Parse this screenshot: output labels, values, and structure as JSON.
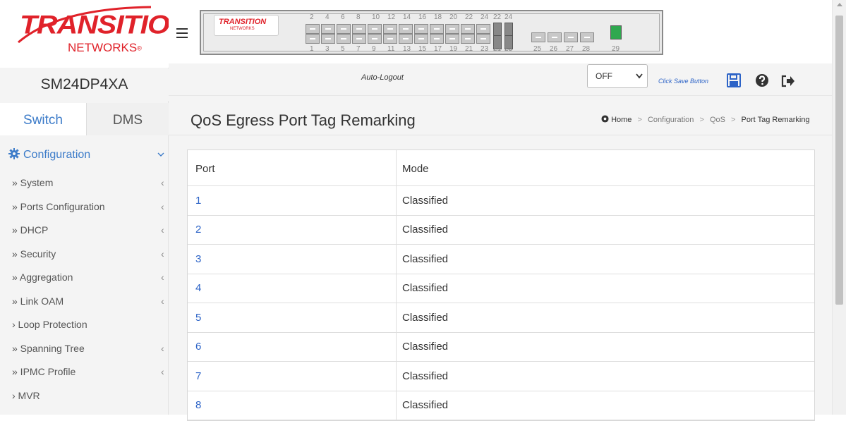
{
  "brand": {
    "name_top": "TRANSITION",
    "name_bottom": "NETWORKS",
    "reg": "®"
  },
  "model": "SM24DP4XA",
  "tabs": [
    {
      "label": "Switch"
    },
    {
      "label": "DMS"
    }
  ],
  "nav": {
    "config_label": "Configuration",
    "items": [
      {
        "label": "» System",
        "arrow": "‹"
      },
      {
        "label": "» Ports Configuration",
        "arrow": "‹"
      },
      {
        "label": "» DHCP",
        "arrow": "‹"
      },
      {
        "label": "» Security",
        "arrow": "‹"
      },
      {
        "label": "» Aggregation",
        "arrow": "‹"
      },
      {
        "label": "» Link OAM",
        "arrow": "‹"
      },
      {
        "label": "› Loop Protection",
        "arrow": ""
      },
      {
        "label": "» Spanning Tree",
        "arrow": "‹"
      },
      {
        "label": "» IPMC Profile",
        "arrow": "‹"
      },
      {
        "label": "› MVR",
        "arrow": ""
      }
    ]
  },
  "panel": {
    "logo_top": "TRANSITION",
    "logo_bottom": "NETWORKS",
    "top_ports": [
      "2",
      "4",
      "6",
      "8",
      "10",
      "12",
      "14",
      "16",
      "18",
      "20",
      "22",
      "24",
      "22",
      "24"
    ],
    "bottom_ports": [
      "1",
      "3",
      "5",
      "7",
      "9",
      "11",
      "13",
      "15",
      "17",
      "19",
      "21",
      "23",
      "21",
      "23",
      "25",
      "26",
      "27",
      "28",
      "29"
    ]
  },
  "header": {
    "autologout_label": "Auto-Logout",
    "autologout_value": "OFF",
    "save_hint": "Click Save Button"
  },
  "page": {
    "title": "QoS Egress Port Tag Remarking",
    "breadcrumb": {
      "home": "Home",
      "config": "Configuration",
      "qos": "QoS",
      "current": "Port Tag Remarking"
    }
  },
  "table": {
    "headers": {
      "port": "Port",
      "mode": "Mode"
    },
    "rows": [
      {
        "port": "1",
        "mode": "Classified"
      },
      {
        "port": "2",
        "mode": "Classified"
      },
      {
        "port": "3",
        "mode": "Classified"
      },
      {
        "port": "4",
        "mode": "Classified"
      },
      {
        "port": "5",
        "mode": "Classified"
      },
      {
        "port": "6",
        "mode": "Classified"
      },
      {
        "port": "7",
        "mode": "Classified"
      },
      {
        "port": "8",
        "mode": "Classified"
      }
    ]
  },
  "colors": {
    "accent": "#3d7cc9",
    "brand": "#e0222a",
    "link": "#2c63c7"
  }
}
